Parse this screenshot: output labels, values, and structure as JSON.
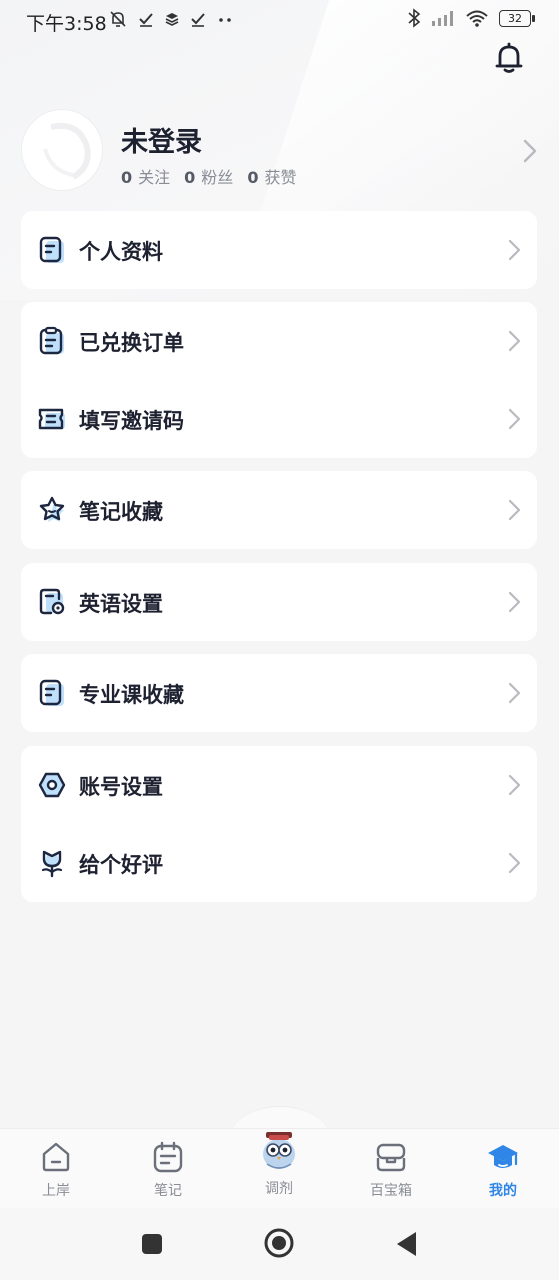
{
  "status_bar": {
    "time": "下午3:58",
    "left_icons": [
      "mute-bell-icon",
      "check-icon",
      "layers-icon",
      "check-icon",
      "more-dots-icon"
    ],
    "battery": "32"
  },
  "profile": {
    "name": "未登录",
    "stats": [
      {
        "count": "0",
        "label": "关注"
      },
      {
        "count": "0",
        "label": "粉丝"
      },
      {
        "count": "0",
        "label": "获赞"
      }
    ]
  },
  "menu": {
    "personal_info": "个人资料",
    "orders": "已兑换订单",
    "invite_code": "填写邀请码",
    "notes_fav": "笔记收藏",
    "english_settings": "英语设置",
    "major_fav": "专业课收藏",
    "account_settings": "账号设置",
    "rate_us": "给个好评"
  },
  "bottom_nav": {
    "items": [
      {
        "label": "上岸",
        "icon": "home-icon"
      },
      {
        "label": "笔记",
        "icon": "notebook-icon"
      },
      {
        "label": "调剂",
        "icon": "mascot-icon"
      },
      {
        "label": "百宝箱",
        "icon": "toolbox-icon"
      },
      {
        "label": "我的",
        "icon": "graduation-cap-icon"
      }
    ],
    "active_index": 4
  },
  "colors": {
    "accent": "#2f86e6",
    "icon_dark": "#1d2740",
    "icon_light": "#bfe0fb",
    "page_bg": "#f5f5f6",
    "card_bg": "#ffffff"
  }
}
